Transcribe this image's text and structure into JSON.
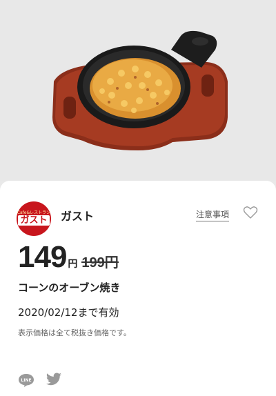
{
  "hero": {
    "image_description_icon": "dish-photo"
  },
  "shop": {
    "logo_top": "Cafe&レストラン",
    "logo_main": "ガスト",
    "name": "ガスト"
  },
  "terms_link": "注意事項",
  "price": {
    "current": "149",
    "unit": "円",
    "original": "199円"
  },
  "product_name": "コーンのオーブン焼き",
  "validity": "2020/02/12まで有効",
  "note": "表示価格は全て税抜き価格です。",
  "share": {
    "icons": [
      "line-icon",
      "twitter-icon"
    ]
  },
  "colors": {
    "brand_red": "#c8161d",
    "card_bg": "#ffffff",
    "hero_bg": "#e8e8e8"
  }
}
